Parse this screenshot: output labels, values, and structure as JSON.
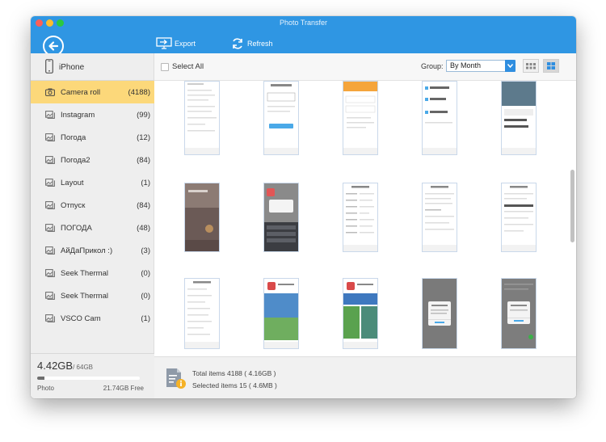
{
  "window": {
    "title": "Photo Transfer"
  },
  "toolbar": {
    "export_label": "Export",
    "refresh_label": "Refresh"
  },
  "device": {
    "name": "iPhone"
  },
  "albums": [
    {
      "name": "Camera roll",
      "count": "(4188)",
      "selected": true
    },
    {
      "name": "Instagram",
      "count": "(99)"
    },
    {
      "name": "Погода",
      "count": "(12)"
    },
    {
      "name": "Погода2",
      "count": "(84)"
    },
    {
      "name": "Layout",
      "count": "(1)"
    },
    {
      "name": "Отпуск",
      "count": "(84)"
    },
    {
      "name": "ПОГОДА",
      "count": "(48)"
    },
    {
      "name": "АйДаПрикол :)",
      "count": "(3)"
    },
    {
      "name": "Seek Thermal",
      "count": "(0)"
    },
    {
      "name": "Seek Thermal",
      "count": "(0)"
    },
    {
      "name": "VSCO Cam",
      "count": "(1)"
    }
  ],
  "storage": {
    "used": "4.42GB",
    "total": "/ 64GB",
    "category": "Photo",
    "free": "21.74GB Free",
    "used_fraction": 0.07
  },
  "content_toolbar": {
    "select_all_label": "Select All",
    "group_label": "Group:",
    "group_value": "By Month"
  },
  "status": {
    "total_text": "Total items 4188 ( 4.16GB )",
    "selected_text": "Selected items 15 ( 4.6MB )"
  },
  "thumbnails": {
    "count": 15,
    "rows": 3,
    "columns": 5
  },
  "colors": {
    "accent": "#2f96e3",
    "selected_album": "#fcd87a"
  }
}
